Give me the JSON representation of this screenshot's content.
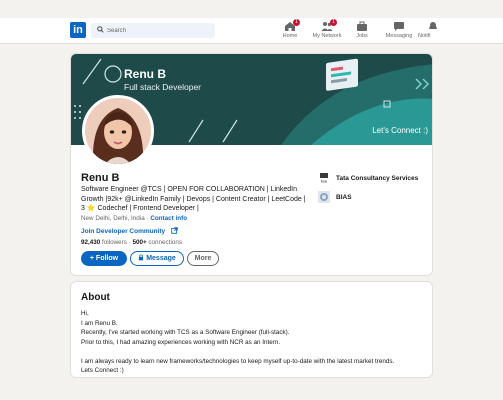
{
  "nav": {
    "logo": "in",
    "search_placeholder": "Search",
    "items": [
      {
        "label": "Home",
        "icon": "home-icon",
        "badge": "1"
      },
      {
        "label": "My Network",
        "icon": "network-icon",
        "badge": "1"
      },
      {
        "label": "Jobs",
        "icon": "jobs-icon",
        "badge": ""
      },
      {
        "label": "Messaging",
        "icon": "messaging-icon",
        "badge": ""
      },
      {
        "label": "Notifi",
        "icon": "notifications-icon",
        "badge": ""
      }
    ]
  },
  "banner": {
    "name": "Renu B",
    "role": "Full stack Developer",
    "cta": "Let's Connect :)"
  },
  "profile": {
    "name": "Renu B",
    "headline": "Software Engineer @TCS | OPEN FOR COLLABORATION | LinkedIn Growth |92k+ @LinkedIn Family | Devops | Content Creator | LeetCode | 3 ⭐ Codechef | Frontend Developer |",
    "location": "New Delhi, Delhi, India",
    "location_sep": " · ",
    "contact_info": "Contact info",
    "developer_community": "Join Developer Community",
    "followers": "92,430",
    "followers_label": " followers · ",
    "connections": "500+",
    "connections_label": " connections",
    "companies": [
      {
        "name": "Tata Consultancy Services"
      },
      {
        "name": "BIAS"
      }
    ]
  },
  "actions": {
    "follow": "+ Follow",
    "message": "Message",
    "more": "More"
  },
  "about": {
    "title": "About",
    "lines": [
      "Hi,",
      "I am Renu B.",
      "Recently, I've started working with TCS as a Software Engineer (full-stack).",
      "Prior to this, I had amazing experiences working with NCR as an Intern.",
      "",
      "I am always ready to learn new frameworks/technologies to keep myself up-to-date with the latest market trends.",
      "Lets Connect :)"
    ]
  },
  "colors": {
    "brand": "#0a66c2",
    "banner": "#1e4a4a",
    "banner_accent": "#2fb7b0",
    "badge": "#cb112d"
  }
}
